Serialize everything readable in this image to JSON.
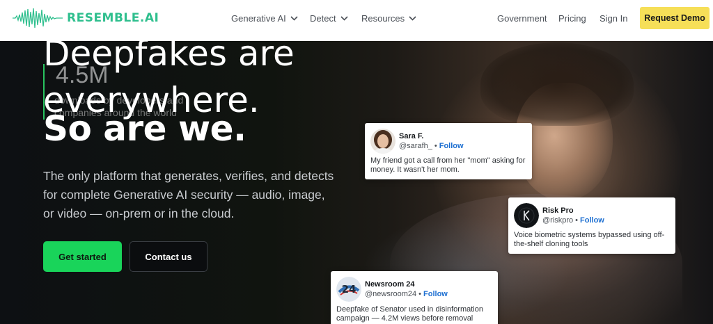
{
  "nav": {
    "logo_text": "RESEMBLE.AI",
    "items": [
      {
        "label": "Generative AI",
        "dropdown": true
      },
      {
        "label": "Detect",
        "dropdown": true
      },
      {
        "label": "Resources",
        "dropdown": true
      },
      {
        "label": "Government",
        "dropdown": false
      },
      {
        "label": "Pricing",
        "dropdown": false
      },
      {
        "label": "Sign In",
        "dropdown": false
      }
    ],
    "cta_label": "Request Demo"
  },
  "hero": {
    "headline_line1": "Deepfakes are",
    "headline_line2": "everywhere.",
    "headline_strong": "So are we.",
    "stat_number": "4.5M",
    "stat_caption": "downloads by developers and companies around the world",
    "paragraph": "The only platform that generates, verifies, and detects for complete Generative AI security — audio, image, or video — on-prem or in the cloud.",
    "primary_button": "Get started",
    "secondary_button": "Contact us"
  },
  "cards": [
    {
      "name": "Sara F.",
      "handle": "@sarafh_",
      "follow": "Follow",
      "text": "My friend got a call from her \"mom\" asking for money. It wasn't her mom."
    },
    {
      "name": "Risk Pro",
      "handle": "@riskpro",
      "follow": "Follow",
      "text": "Voice biometric systems bypassed using off-the-shelf cloning tools"
    },
    {
      "name": "Newsroom 24",
      "handle": "@newsroom24",
      "follow": "Follow",
      "text": "Deepfake of Senator used in disinformation campaign — 4.2M views before removal"
    }
  ],
  "colors": {
    "brand": "#2fbf8e",
    "cta_yellow": "#f6df58",
    "primary_green": "#19d45a",
    "follow_blue": "#1d6fd1"
  },
  "icons": {
    "logo": "waveform-icon",
    "dropdown": "chevron-down-icon"
  }
}
